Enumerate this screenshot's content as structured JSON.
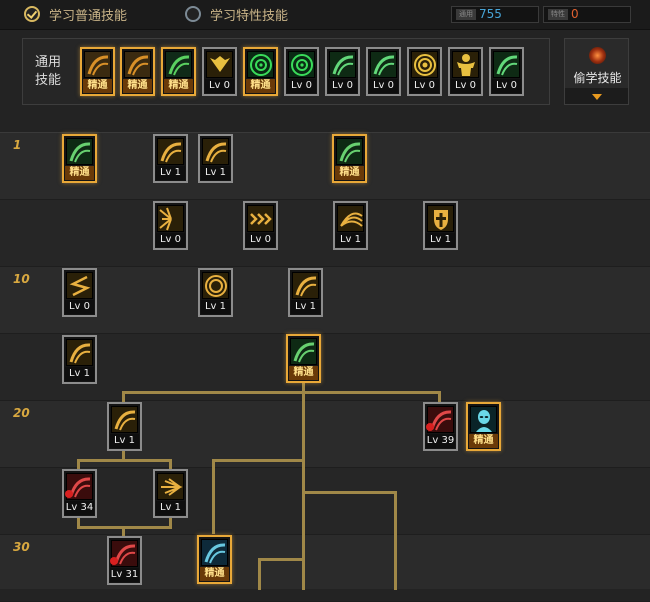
{
  "header": {
    "tab_common_label": "学习普通技能",
    "tab_special_label": "学习特性技能",
    "points": [
      {
        "label": "通用",
        "value": "755"
      },
      {
        "label": "特性",
        "value": "0"
      }
    ]
  },
  "common_panel": {
    "title": "通用技能",
    "skills": [
      {
        "name": "kneel",
        "cap": "精通"
      },
      {
        "name": "dodge",
        "cap": "精通"
      },
      {
        "name": "dragon",
        "cap": "精通"
      },
      {
        "name": "wings",
        "cap": "Lv 0"
      },
      {
        "name": "target",
        "cap": "精通"
      },
      {
        "name": "target-2",
        "cap": "Lv 0"
      },
      {
        "name": "dash",
        "cap": "Lv 0"
      },
      {
        "name": "slash",
        "cap": "Lv 0"
      },
      {
        "name": "eye",
        "cap": "Lv 0"
      },
      {
        "name": "muscle",
        "cap": "Lv 0"
      },
      {
        "name": "lizard",
        "cap": "Lv 0"
      }
    ]
  },
  "steal_button": {
    "label": "偷学技能"
  },
  "tree": {
    "levels": [
      "1",
      "10",
      "20",
      "30"
    ],
    "skills": [
      {
        "name": "demon",
        "cap": "精通"
      },
      {
        "name": "swing",
        "cap": "Lv 1"
      },
      {
        "name": "whirl",
        "cap": "Lv 1"
      },
      {
        "name": "star",
        "cap": "精通"
      },
      {
        "name": "burst",
        "cap": "Lv 0"
      },
      {
        "name": "chevron",
        "cap": "Lv 0"
      },
      {
        "name": "fan",
        "cap": "Lv 1"
      },
      {
        "name": "shield",
        "cap": "Lv 1"
      },
      {
        "name": "zigzag",
        "cap": "Lv 0"
      },
      {
        "name": "vortex",
        "cap": "Lv 1"
      },
      {
        "name": "spike",
        "cap": "Lv 1"
      },
      {
        "name": "cut",
        "cap": "Lv 1"
      },
      {
        "name": "wind",
        "cap": "精通"
      },
      {
        "name": "crescent",
        "cap": "Lv 1"
      },
      {
        "name": "blood",
        "cap": "Lv 39"
      },
      {
        "name": "alien",
        "cap": "精通"
      },
      {
        "name": "claw",
        "cap": "Lv 34"
      },
      {
        "name": "quill",
        "cap": "Lv 1"
      },
      {
        "name": "mark",
        "cap": "Lv 31"
      },
      {
        "name": "wave",
        "cap": "精通"
      }
    ]
  }
}
